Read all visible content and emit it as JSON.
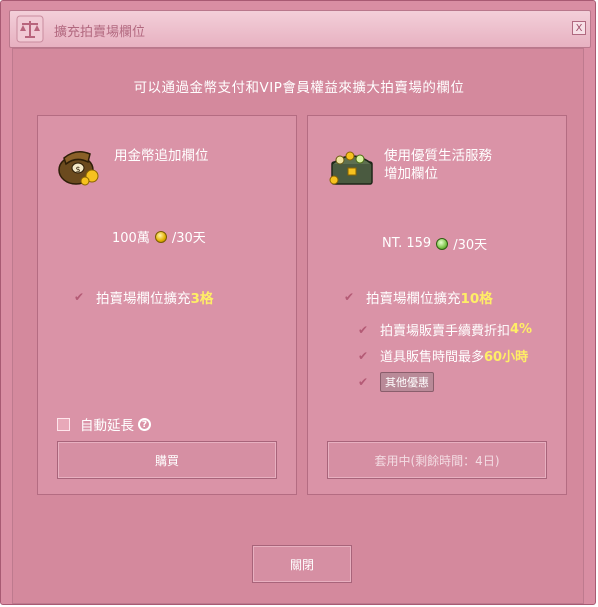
{
  "window": {
    "title": "擴充拍賣場欄位",
    "close_label": "X"
  },
  "subtitle": "可以通過金幣支付和VIP會員權益來擴大拍賣場的欄位",
  "left_panel": {
    "title": "用金幣追加欄位",
    "price_amount": "100萬",
    "price_period": "/30天",
    "feature_text": "拍賣場欄位擴充",
    "feature_value": "3格",
    "auto_renew_label": "自動延長",
    "help_label": "?",
    "buy_button": "購買"
  },
  "right_panel": {
    "title_line1": "使用優質生活服務",
    "title_line2": "增加欄位",
    "price_amount": "NT. 159",
    "price_period": "/30天",
    "features": [
      {
        "text": "拍賣場欄位擴充",
        "value": "10格"
      },
      {
        "text": "拍賣場販賣手續費折扣",
        "value": "4%"
      },
      {
        "text": "道具販售時間最多",
        "value": "60小時"
      }
    ],
    "other_benefits": "其他優惠",
    "status_button": "套用中(剩餘時間：4日)"
  },
  "close_button": "關閉",
  "colors": {
    "window_bg": "#d98ea3",
    "panel_bg": "#da93a7",
    "highlight": "#ffee66",
    "check": "#b45a75"
  },
  "icons": {
    "title": "scales-icon",
    "left_item": "money-bag-icon",
    "right_item": "treasure-chest-icon",
    "coin": "gold-coin-icon",
    "coin_right": "green-coin-icon",
    "check": "checkmark-icon"
  }
}
